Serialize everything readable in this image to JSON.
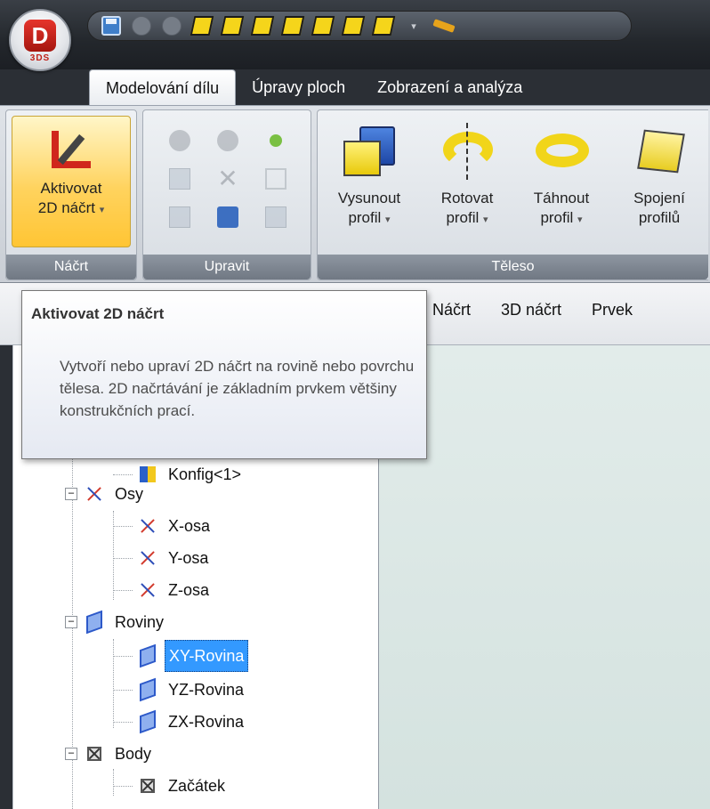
{
  "app": {
    "logo_letter": "D",
    "logo_subtext": "3DS"
  },
  "ribbon_tabs": [
    {
      "label": "Modelování dílu",
      "active": true
    },
    {
      "label": "Úpravy ploch",
      "active": false
    },
    {
      "label": "Zobrazení a analýza",
      "active": false
    }
  ],
  "groups": {
    "sketch": {
      "label": "Náčrt",
      "activate_button_line1": "Aktivovat",
      "activate_button_line2": "2D náčrt"
    },
    "edit": {
      "label": "Upravit"
    },
    "body": {
      "label": "Těleso",
      "buttons": [
        {
          "line1": "Vysunout",
          "line2": "profil",
          "has_dropdown": true
        },
        {
          "line1": "Rotovat",
          "line2": "profil",
          "has_dropdown": true
        },
        {
          "line1": "Táhnout",
          "line2": "profil",
          "has_dropdown": true
        },
        {
          "line1": "Spojení",
          "line2": "profilů",
          "has_dropdown": false
        }
      ]
    }
  },
  "subtabs": [
    "Náčrt",
    "3D náčrt",
    "Prvek"
  ],
  "tooltip": {
    "title": "Aktivovat 2D náčrt",
    "body": "Vytvoří nebo upraví 2D náčrt na rovině nebo povrchu tělesa. 2D načrtávání je základním prvkem většiny konstrukčních prací."
  },
  "tree": {
    "partial_item": "Konfig<1>",
    "axes": {
      "label": "Osy",
      "children": [
        "X-osa",
        "Y-osa",
        "Z-osa"
      ]
    },
    "planes": {
      "label": "Roviny",
      "children": [
        "XY-Rovina",
        "YZ-Rovina",
        "ZX-Rovina"
      ],
      "selected": "XY-Rovina"
    },
    "points": {
      "label": "Body",
      "children": [
        "Začátek"
      ]
    }
  },
  "colors": {
    "selection": "#3399ff",
    "hot_button": "#ffd35e",
    "viewport": "#dbe7e4"
  }
}
